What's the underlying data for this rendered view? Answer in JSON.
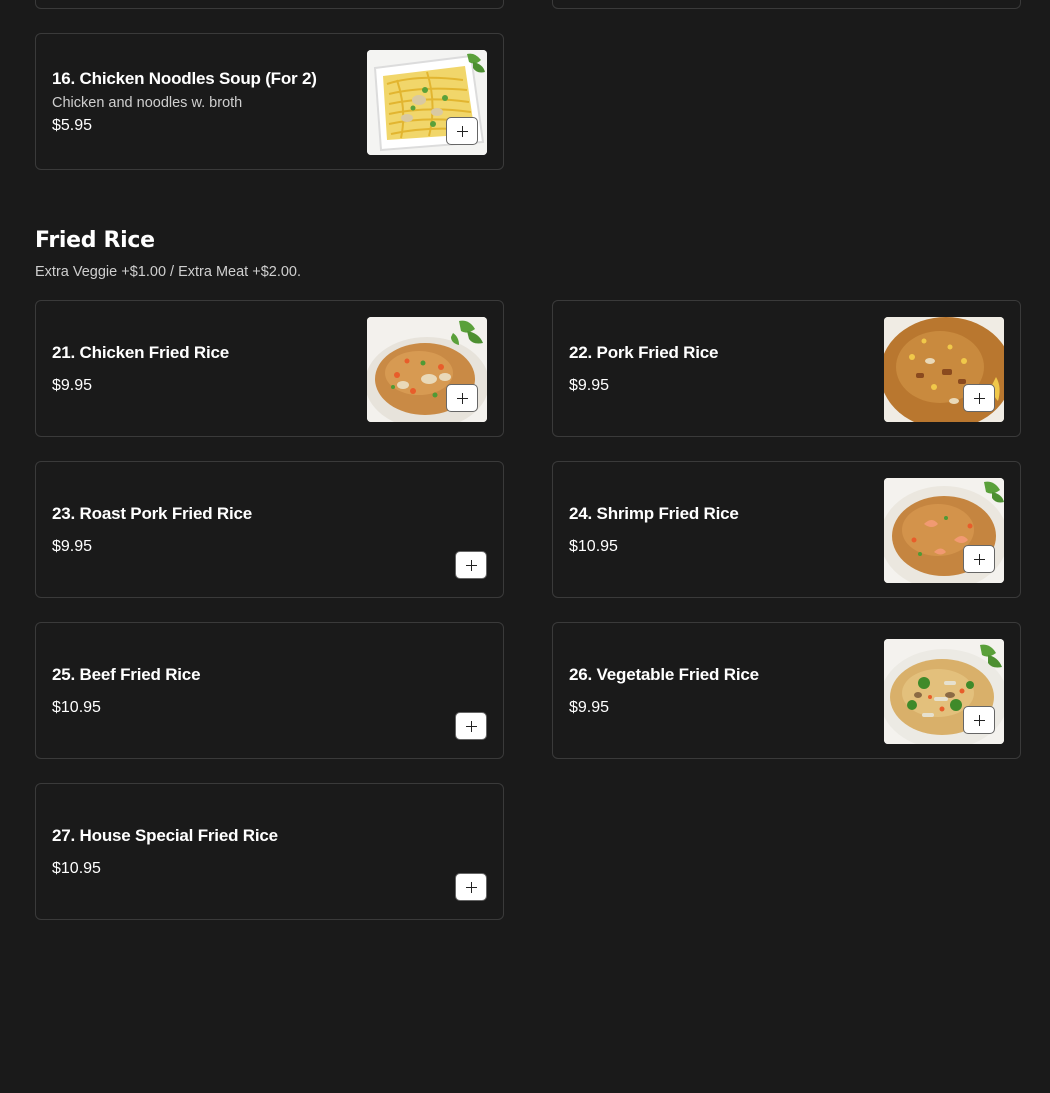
{
  "top_partial_cards": [
    {
      "id": "left"
    },
    {
      "id": "right"
    }
  ],
  "soup_item": {
    "name": "16. Chicken Noodles Soup (For 2)",
    "description": "Chicken and noodles w. broth",
    "price": "$5.95",
    "image": "chicken-noodle-soup-photo"
  },
  "section": {
    "title": "Fried Rice",
    "note": "Extra Veggie +$1.00 / Extra Meat +$2.00."
  },
  "items": [
    {
      "name": "21. Chicken Fried Rice",
      "price": "$9.95",
      "image": "chicken-fried-rice-photo"
    },
    {
      "name": "22. Pork Fried Rice",
      "price": "$9.95",
      "image": "pork-fried-rice-photo"
    },
    {
      "name": "23. Roast Pork Fried Rice",
      "price": "$9.95",
      "image": ""
    },
    {
      "name": "24. Shrimp Fried Rice",
      "price": "$10.95",
      "image": "shrimp-fried-rice-photo"
    },
    {
      "name": "25. Beef Fried Rice",
      "price": "$10.95",
      "image": ""
    },
    {
      "name": "26. Vegetable Fried Rice",
      "price": "$9.95",
      "image": "vegetable-fried-rice-photo"
    },
    {
      "name": "27. House Special Fried Rice",
      "price": "$10.95",
      "image": ""
    }
  ],
  "add_button_icon": "plus-icon",
  "colors": {
    "background": "#1a1a1a",
    "card_border": "#3a3a3a",
    "text": "#ffffff",
    "muted_text": "#cfcfcf",
    "button_bg": "#ffffff"
  }
}
